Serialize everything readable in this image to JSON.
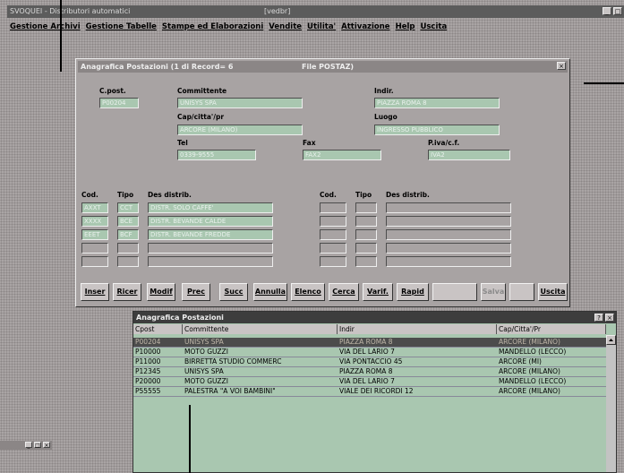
{
  "app": {
    "title": "SVOQUEI - Distributori automatici",
    "doc": "[vedbr]",
    "window_buttons": [
      "_",
      "□",
      "×"
    ]
  },
  "menu": [
    "Gestione Archivi",
    "Gestione Tabelle",
    "Stampe ed Elaborazioni",
    "Vendite",
    "Utilita'",
    "Attivazione",
    "Help",
    "Uscita"
  ],
  "dialog": {
    "title": "Anagrafica Postazioni  (1 di Record= 6",
    "file": "File POSTAZ)",
    "close": "×",
    "labels": {
      "cpost": "C.post.",
      "committente": "Committente",
      "indir": "Indir.",
      "cap": "Cap/citta'/pr",
      "luogo": "Luogo",
      "tel": "Tel",
      "fax": "Fax",
      "piva": "P.iva/c.f.",
      "cod": "Cod.",
      "tipo": "Tipo",
      "desc": "Des distrib.",
      "cod2": "Cod.",
      "tipo2": "Tipo",
      "desc2": "Des distrib."
    },
    "values": {
      "cpost": "P00204",
      "committente": "UNISYS SPA",
      "indir": "PIAZZA ROMA 8",
      "cap": "ARCORE (MILANO)",
      "luogo": "INGRESSO PUBBLICO",
      "tel": "0339-9555",
      "fax": "FAX2",
      "piva": "IVA2"
    },
    "distrib": [
      {
        "cod": "AXXT",
        "tipo": "CCT",
        "desc": "DISTR. SOLO CAFFE'"
      },
      {
        "cod": "XXXX",
        "tipo": "BCE",
        "desc": "DISTR. BEVANDE CALDE"
      },
      {
        "cod": "EEET",
        "tipo": "BCF",
        "desc": "DISTR. BEVANDE FREDDE"
      }
    ],
    "buttons": [
      "Inser",
      "Ricer",
      "Modif",
      "Prec",
      "Succ",
      "Annulla",
      "Elenco",
      "Cerca",
      "Varif.",
      "Rapid",
      "",
      "Salva",
      "",
      "Uscita"
    ]
  },
  "list": {
    "title": "Anagrafica Postazioni",
    "title_buttons": [
      "?",
      "×"
    ],
    "headers": [
      "Cpost",
      "Committente",
      "Indir",
      "Cap/Citta'/Pr"
    ],
    "rows": [
      [
        "P00204",
        "UNISYS SPA",
        "PIAZZA ROMA 8",
        "ARCORE (MILANO)"
      ],
      [
        "P10000",
        "MOTO GUZZI",
        "VIA DEL LARIO 7",
        "MANDELLO (LECCO)"
      ],
      [
        "P11000",
        "BIRRETTA STUDIO COMMERC",
        "VIA PONTACCIO 45",
        "ARCORE    (MI)"
      ],
      [
        "P12345",
        "UNISYS SPA",
        "PIAZZA ROMA 8",
        "ARCORE (MILANO)"
      ],
      [
        "P20000",
        "MOTO GUZZI",
        "VIA DEL LARIO 7",
        "MANDELLO (LECCO)"
      ],
      [
        "P55555",
        "PALESTRA \"A VOI BAMBINI\"",
        "VIALE DEI RICORDI 12",
        "ARCORE (MILANO)"
      ]
    ],
    "selected_row": 0
  },
  "fragment": {
    "buttons": [
      "_",
      "□",
      "×"
    ]
  }
}
